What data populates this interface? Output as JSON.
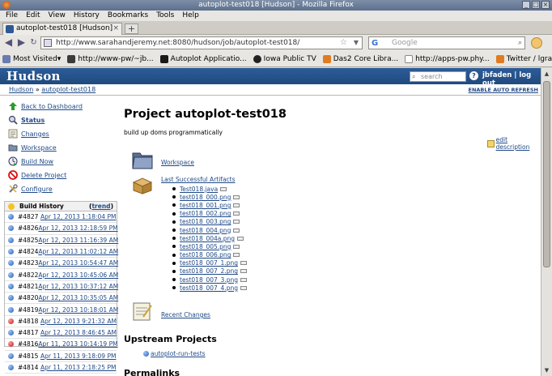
{
  "window": {
    "title": "autoplot-test018 [Hudson] - Mozilla Firefox"
  },
  "menu": [
    "File",
    "Edit",
    "View",
    "History",
    "Bookmarks",
    "Tools",
    "Help"
  ],
  "tab": {
    "title": "autoplot-test018 [Hudson]"
  },
  "url": "http://www.sarahandjeremy.net:8080/hudson/job/autoplot-test018/",
  "search_engine": {
    "name": "G",
    "placeholder": "Google"
  },
  "bookmarks": [
    {
      "label": "Most Visited▾",
      "color": "#6a7bb0"
    },
    {
      "label": "http://www-pw/~jb...",
      "color": "#3b3b3b"
    },
    {
      "label": "Autoplot Applicatio...",
      "color": "#1a1a1a"
    },
    {
      "label": "Iowa Public TV",
      "color": "#222"
    },
    {
      "label": "Das2 Core Libra...",
      "color": "#e07b1f"
    },
    {
      "label": "http://apps-pw.phy...",
      "color": "#888"
    },
    {
      "label": "Twitter / lgranroth",
      "color": "#4aa3df"
    }
  ],
  "hudson": {
    "logo": "Hudson",
    "search_placeholder": "search",
    "help": "?",
    "user": "jbfaden | log out",
    "breadcrumb": [
      "Hudson",
      "»",
      "autoplot-test018"
    ],
    "auto_refresh": "ENABLE AUTO REFRESH"
  },
  "sidebar": [
    {
      "label": "Back to Dashboard",
      "icon": "up-arrow-icon",
      "bold": false
    },
    {
      "label": "Status",
      "icon": "magnifier-icon",
      "bold": true
    },
    {
      "label": "Changes",
      "icon": "notepad-icon",
      "bold": false
    },
    {
      "label": "Workspace",
      "icon": "folder-icon",
      "bold": false
    },
    {
      "label": "Build Now",
      "icon": "clock-icon",
      "bold": false
    },
    {
      "label": "Delete Project",
      "icon": "no-entry-icon",
      "bold": false
    },
    {
      "label": "Configure",
      "icon": "wrench-icon",
      "bold": false
    }
  ],
  "build_history": {
    "title": "Build History",
    "trend": "trend",
    "builds": [
      {
        "num": "#4827",
        "date": "Apr 12, 2013 1:18:04 PM",
        "status": "blue"
      },
      {
        "num": "#4826",
        "date": "Apr 12, 2013 12:18:59 PM",
        "status": "blue"
      },
      {
        "num": "#4825",
        "date": "Apr 12, 2013 11:16:39 AM",
        "status": "blue"
      },
      {
        "num": "#4824",
        "date": "Apr 12, 2013 11:02:12 AM",
        "status": "blue"
      },
      {
        "num": "#4823",
        "date": "Apr 12, 2013 10:54:47 AM",
        "status": "blue"
      },
      {
        "num": "#4822",
        "date": "Apr 12, 2013 10:45:06 AM",
        "status": "blue"
      },
      {
        "num": "#4821",
        "date": "Apr 12, 2013 10:37:12 AM",
        "status": "blue"
      },
      {
        "num": "#4820",
        "date": "Apr 12, 2013 10:35:05 AM",
        "status": "blue"
      },
      {
        "num": "#4819",
        "date": "Apr 12, 2013 10:18:01 AM",
        "status": "blue"
      },
      {
        "num": "#4818",
        "date": "Apr 12, 2013 9:21:32 AM",
        "status": "red"
      },
      {
        "num": "#4817",
        "date": "Apr 12, 2013 8:46:45 AM",
        "status": "blue"
      },
      {
        "num": "#4816",
        "date": "Apr 11, 2013 10:14:19 PM",
        "status": "red"
      },
      {
        "num": "#4815",
        "date": "Apr 11, 2013 9:18:09 PM",
        "status": "blue"
      },
      {
        "num": "#4814",
        "date": "Apr 11, 2013 2:18:25 PM",
        "status": "blue"
      }
    ]
  },
  "project": {
    "title": "Project autoplot-test018",
    "description": "build up doms programmatically",
    "edit_description": "edit description",
    "workspace": "Workspace",
    "last_successful": "Last Successful Artifacts",
    "artifacts": [
      "Test018.java",
      "test018_000.png",
      "test018_001.png",
      "test018_002.png",
      "test018_003.png",
      "test018_004.png",
      "test018_004a.png",
      "test018_005.png",
      "test018_006.png",
      "test018_007_1.png",
      "test018_007_2.png",
      "test018_007_3.png",
      "test018_007_4.png"
    ],
    "recent_changes": "Recent Changes",
    "upstream_title": "Upstream Projects",
    "upstream": [
      "autoplot-run-tests"
    ],
    "permalinks_title": "Permalinks"
  }
}
